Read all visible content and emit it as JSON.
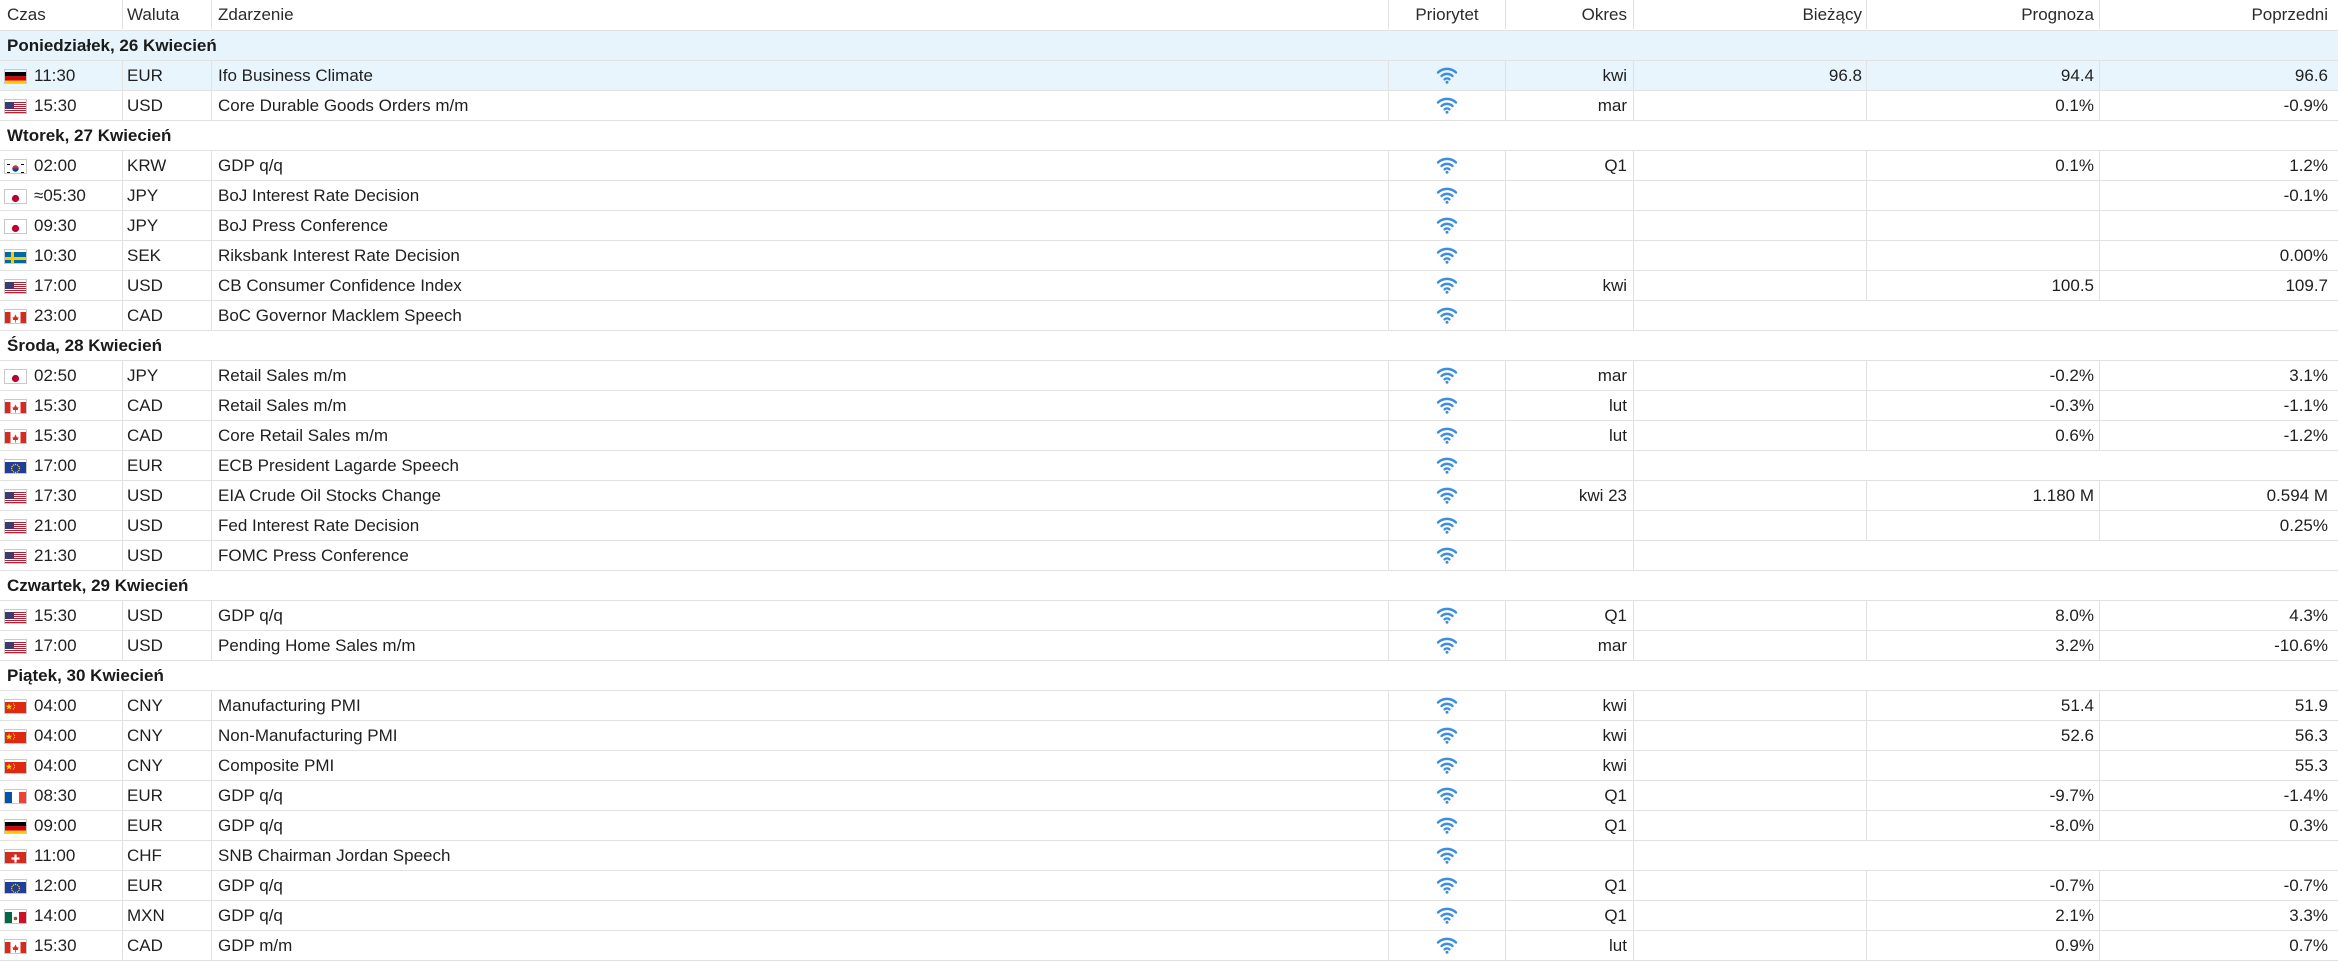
{
  "columns": {
    "time": "Czas",
    "currency": "Waluta",
    "event": "Zdarzenie",
    "priority": "Priorytet",
    "period": "Okres",
    "actual": "Bieżący",
    "forecast": "Prognoza",
    "previous": "Poprzedni"
  },
  "priority_icon": "wifi-signal-icon",
  "priority_color": "#3b8de0",
  "highlight_color": "#e8f4fb",
  "days": [
    {
      "label": "Poniedziałek, 26 Kwiecień",
      "events": [
        {
          "flag": "de",
          "time": "11:30",
          "currency": "EUR",
          "event": "Ifo Business Climate",
          "period": "kwi",
          "actual": "96.8",
          "forecast": "94.4",
          "previous": "96.6"
        },
        {
          "flag": "us",
          "time": "15:30",
          "currency": "USD",
          "event": "Core Durable Goods Orders m/m",
          "period": "mar",
          "actual": "",
          "forecast": "0.1%",
          "previous": "-0.9%"
        }
      ]
    },
    {
      "label": "Wtorek, 27 Kwiecień",
      "events": [
        {
          "flag": "kr",
          "time": "02:00",
          "currency": "KRW",
          "event": "GDP q/q",
          "period": "Q1",
          "actual": "",
          "forecast": "0.1%",
          "previous": "1.2%"
        },
        {
          "flag": "jp",
          "time": "≈05:30",
          "currency": "JPY",
          "event": "BoJ Interest Rate Decision",
          "period": "",
          "actual": "",
          "forecast": "",
          "previous": "-0.1%"
        },
        {
          "flag": "jp",
          "time": "09:30",
          "currency": "JPY",
          "event": "BoJ Press Conference",
          "period": "",
          "actual": "",
          "forecast": "",
          "previous": ""
        },
        {
          "flag": "se",
          "time": "10:30",
          "currency": "SEK",
          "event": "Riksbank Interest Rate Decision",
          "period": "",
          "actual": "",
          "forecast": "",
          "previous": "0.00%"
        },
        {
          "flag": "us",
          "time": "17:00",
          "currency": "USD",
          "event": "CB Consumer Confidence Index",
          "period": "kwi",
          "actual": "",
          "forecast": "100.5",
          "previous": "109.7"
        },
        {
          "flag": "ca",
          "time": "23:00",
          "currency": "CAD",
          "event": "BoC Governor Macklem Speech",
          "period": "",
          "actual": "",
          "forecast": "",
          "previous": "",
          "merged": true
        }
      ]
    },
    {
      "label": "Środa, 28 Kwiecień",
      "events": [
        {
          "flag": "jp",
          "time": "02:50",
          "currency": "JPY",
          "event": "Retail Sales m/m",
          "period": "mar",
          "actual": "",
          "forecast": "-0.2%",
          "previous": "3.1%"
        },
        {
          "flag": "ca",
          "time": "15:30",
          "currency": "CAD",
          "event": "Retail Sales m/m",
          "period": "lut",
          "actual": "",
          "forecast": "-0.3%",
          "previous": "-1.1%"
        },
        {
          "flag": "ca",
          "time": "15:30",
          "currency": "CAD",
          "event": "Core Retail Sales m/m",
          "period": "lut",
          "actual": "",
          "forecast": "0.6%",
          "previous": "-1.2%"
        },
        {
          "flag": "eu",
          "time": "17:00",
          "currency": "EUR",
          "event": "ECB President Lagarde Speech",
          "period": "",
          "actual": "",
          "forecast": "",
          "previous": "",
          "merged": true
        },
        {
          "flag": "us",
          "time": "17:30",
          "currency": "USD",
          "event": "EIA Crude Oil Stocks Change",
          "period": "kwi 23",
          "actual": "",
          "forecast": "1.180 M",
          "previous": "0.594 M"
        },
        {
          "flag": "us",
          "time": "21:00",
          "currency": "USD",
          "event": "Fed Interest Rate Decision",
          "period": "",
          "actual": "",
          "forecast": "",
          "previous": "0.25%"
        },
        {
          "flag": "us",
          "time": "21:30",
          "currency": "USD",
          "event": "FOMC Press Conference",
          "period": "",
          "actual": "",
          "forecast": "",
          "previous": "",
          "merged": true
        }
      ]
    },
    {
      "label": "Czwartek, 29 Kwiecień",
      "events": [
        {
          "flag": "us",
          "time": "15:30",
          "currency": "USD",
          "event": "GDP q/q",
          "period": "Q1",
          "actual": "",
          "forecast": "8.0%",
          "previous": "4.3%"
        },
        {
          "flag": "us",
          "time": "17:00",
          "currency": "USD",
          "event": "Pending Home Sales m/m",
          "period": "mar",
          "actual": "",
          "forecast": "3.2%",
          "previous": "-10.6%"
        }
      ]
    },
    {
      "label": "Piątek, 30 Kwiecień",
      "events": [
        {
          "flag": "cn",
          "time": "04:00",
          "currency": "CNY",
          "event": "Manufacturing PMI",
          "period": "kwi",
          "actual": "",
          "forecast": "51.4",
          "previous": "51.9"
        },
        {
          "flag": "cn",
          "time": "04:00",
          "currency": "CNY",
          "event": "Non-Manufacturing PMI",
          "period": "kwi",
          "actual": "",
          "forecast": "52.6",
          "previous": "56.3"
        },
        {
          "flag": "cn",
          "time": "04:00",
          "currency": "CNY",
          "event": "Composite PMI",
          "period": "kwi",
          "actual": "",
          "forecast": "",
          "previous": "55.3"
        },
        {
          "flag": "fr",
          "time": "08:30",
          "currency": "EUR",
          "event": "GDP q/q",
          "period": "Q1",
          "actual": "",
          "forecast": "-9.7%",
          "previous": "-1.4%"
        },
        {
          "flag": "de",
          "time": "09:00",
          "currency": "EUR",
          "event": "GDP q/q",
          "period": "Q1",
          "actual": "",
          "forecast": "-8.0%",
          "previous": "0.3%"
        },
        {
          "flag": "ch",
          "time": "11:00",
          "currency": "CHF",
          "event": "SNB Chairman Jordan Speech",
          "period": "",
          "actual": "",
          "forecast": "",
          "previous": "",
          "merged": true
        },
        {
          "flag": "eu",
          "time": "12:00",
          "currency": "EUR",
          "event": "GDP q/q",
          "period": "Q1",
          "actual": "",
          "forecast": "-0.7%",
          "previous": "-0.7%"
        },
        {
          "flag": "mx",
          "time": "14:00",
          "currency": "MXN",
          "event": "GDP q/q",
          "period": "Q1",
          "actual": "",
          "forecast": "2.1%",
          "previous": "3.3%"
        },
        {
          "flag": "ca",
          "time": "15:30",
          "currency": "CAD",
          "event": "GDP m/m",
          "period": "lut",
          "actual": "",
          "forecast": "0.9%",
          "previous": "0.7%"
        }
      ]
    }
  ]
}
